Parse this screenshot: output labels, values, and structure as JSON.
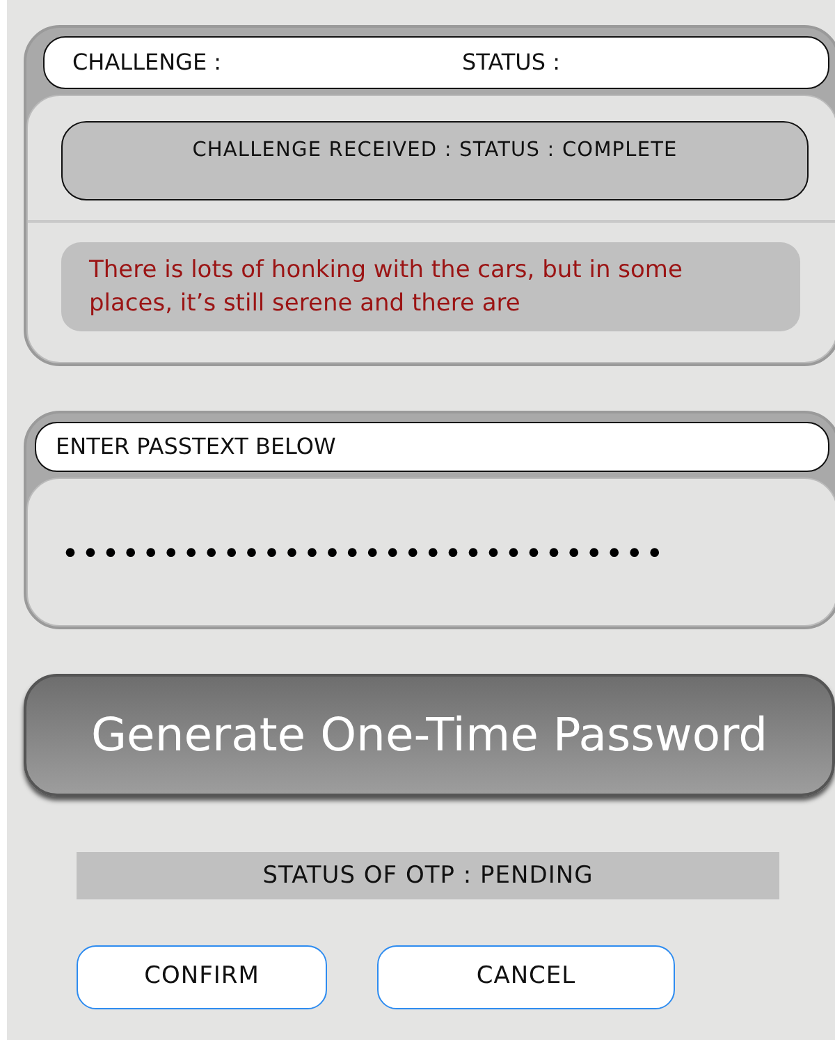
{
  "challenge_panel": {
    "challenge_label": "CHALLENGE :",
    "status_label": "STATUS :",
    "received_status": "CHALLENGE RECEIVED : STATUS : COMPLETE",
    "challenge_text": "There is lots of honking with the cars, but in some places, it’s still serene and there are"
  },
  "passtext_panel": {
    "label": "ENTER PASSTEXT BELOW",
    "value": "••••••••••••••••••••••••••••••"
  },
  "generate_button": "Generate One-Time Password",
  "otp_status": "STATUS OF OTP : PENDING",
  "buttons": [
    "CONFIRM",
    "CANCEL"
  ]
}
